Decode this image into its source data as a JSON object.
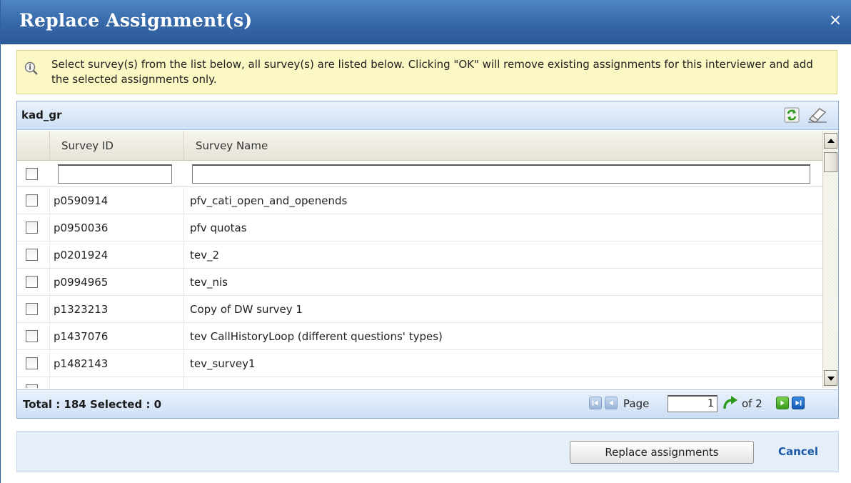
{
  "dialog": {
    "title": "Replace Assignment(s)",
    "close_glyph": "×"
  },
  "info": {
    "icon": "info-magnifier-icon",
    "text": "Select survey(s) from the list below, all survey(s) are listed below. Clicking \"OK\" will remove existing assignments for this interviewer and add the selected assignments only."
  },
  "grid": {
    "name": "kad_gr",
    "columns": {
      "id": "Survey ID",
      "name": "Survey Name"
    },
    "filters": {
      "id": "",
      "name": ""
    },
    "rows": [
      {
        "id": "p0590914",
        "name": "pfv_cati_open_and_openends"
      },
      {
        "id": "p0950036",
        "name": "pfv quotas"
      },
      {
        "id": "p0201924",
        "name": "tev_2"
      },
      {
        "id": "p0994965",
        "name": "tev_nis"
      },
      {
        "id": "p1323213",
        "name": "Copy of DW survey 1"
      },
      {
        "id": "p1437076",
        "name": "tev CallHistoryLoop (different questions' types)"
      },
      {
        "id": "p1482143",
        "name": "tev_survey1"
      }
    ],
    "footer": {
      "total": "Total : 184 Selected : 0",
      "page_label": "Page",
      "page_value": "1",
      "of_label": "of 2"
    }
  },
  "actions": {
    "replace": "Replace assignments",
    "cancel": "Cancel"
  },
  "colors": {
    "titlebar": "#3567a8",
    "info_bg": "#fbf8c4",
    "grid_header": "#cddff5",
    "link": "#1c5aa8"
  }
}
